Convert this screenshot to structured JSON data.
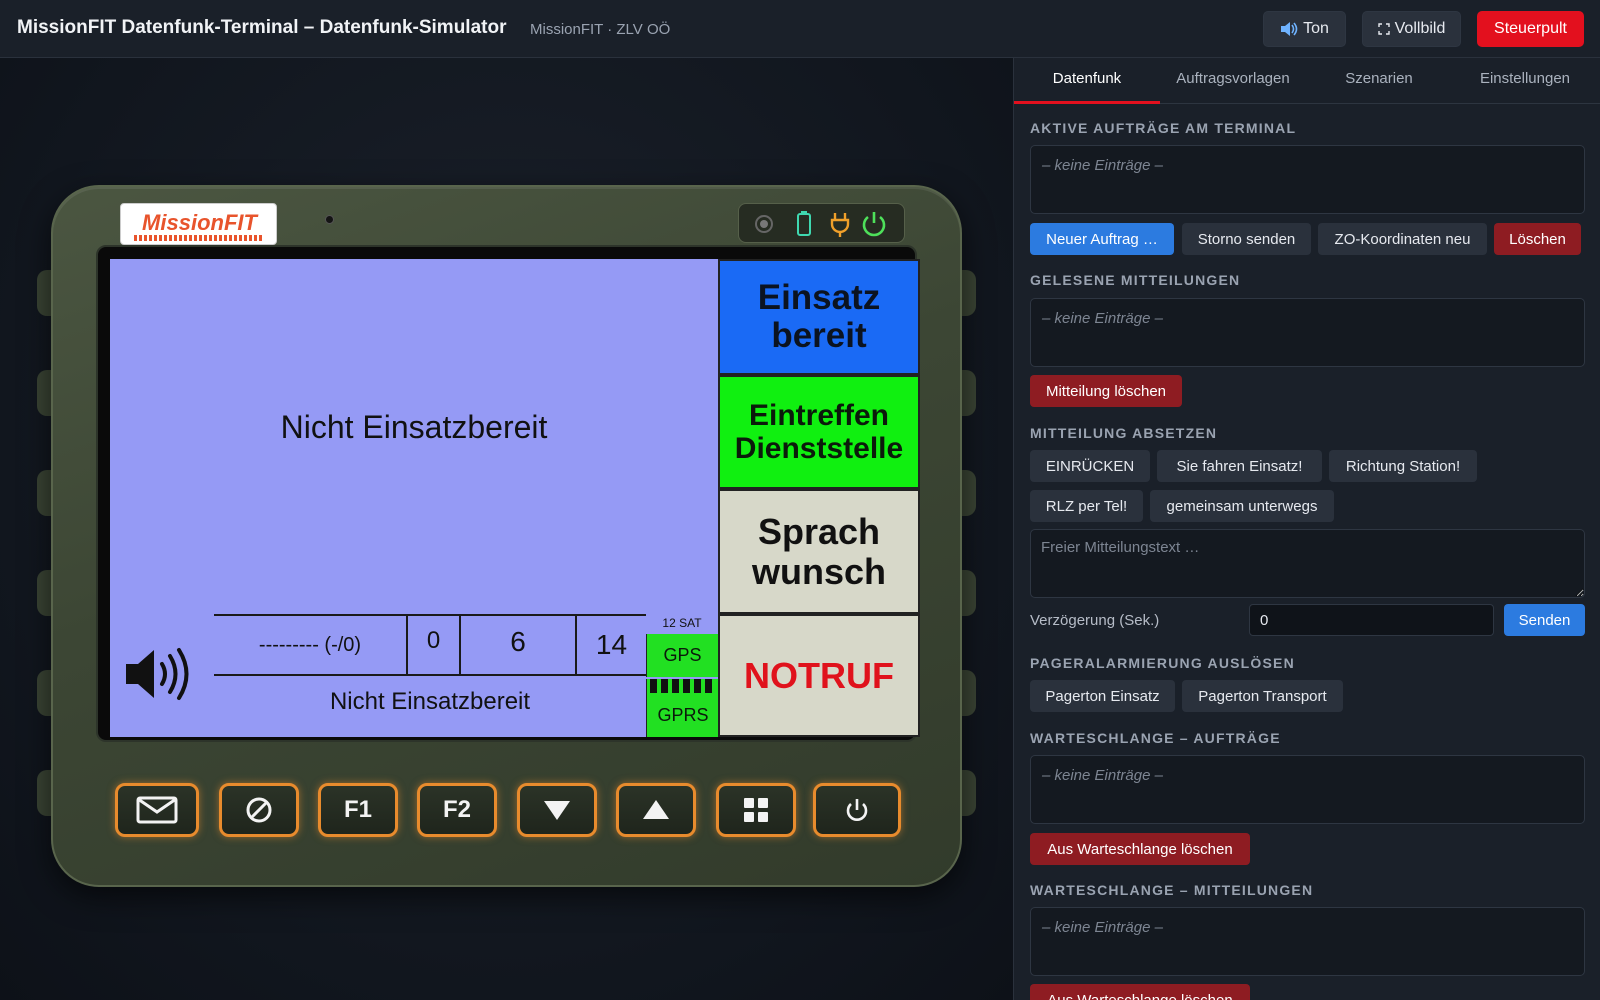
{
  "header": {
    "title": "MissionFIT Datenfunk-Terminal – Datenfunk-Simulator",
    "subtitle": "MissionFIT · ZLV OÖ",
    "buttons": {
      "sound": "Ton",
      "fullscreen": "Vollbild",
      "control": "Steuerpult"
    },
    "sound_icon": "speaker-icon",
    "fullscreen_icon": "fullscreen-icon"
  },
  "device": {
    "logo_text": "MissionFIT",
    "status_main": "Nicht Einsatzbereit",
    "side_buttons": {
      "ready_line1": "Einsatz",
      "ready_line2": "bereit",
      "arrive_line1": "Eintreffen",
      "arrive_line2": "Dienststelle",
      "voice_line1": "Sprach",
      "voice_line2": "wunsch",
      "emergency": "NOTRUF"
    },
    "info": {
      "order": "--------- (-/0)",
      "v1": "0",
      "v2": "6",
      "v3": "14",
      "sat": "12 SAT",
      "gps": "GPS",
      "gprs": "GPRS",
      "status_text": "Nicht Einsatzbereit"
    },
    "hw_buttons": {
      "f1": "F1",
      "f2": "F2"
    },
    "colors": {
      "screen_bg": "#959af5",
      "ready": "#1a6af5",
      "arrive": "#10f010",
      "voice": "#d7d8c9",
      "emergency_text": "#e0121c",
      "hw_glow": "#e88b2d"
    }
  },
  "panel": {
    "tabs": [
      "Datenfunk",
      "Auftragsvorlagen",
      "Szenarien",
      "Einstellungen"
    ],
    "active_tab": "Datenfunk",
    "empty_text": "– keine Einträge –",
    "active_orders": {
      "heading": "Aktive Aufträge am Terminal",
      "buttons": [
        "Neuer Auftrag …",
        "Storno senden",
        "ZO-Koordinaten neu",
        "Löschen"
      ]
    },
    "read_messages": {
      "heading": "Gelesene Mitteilungen",
      "delete_button": "Mitteilung löschen"
    },
    "send_message": {
      "heading": "Mitteilung absetzen",
      "quick": [
        "EINRÜCKEN",
        "Sie fahren Einsatz!",
        "Richtung Station!",
        "RLZ per Tel!",
        "gemeinsam unterwegs"
      ],
      "placeholder": "Freier Mitteilungstext …",
      "delay_label": "Verzögerung (Sek.)",
      "delay_value": "0",
      "send_button": "Senden"
    },
    "pager": {
      "heading": "Pageralarmierung auslösen",
      "buttons": [
        "Pagerton Einsatz",
        "Pagerton Transport"
      ]
    },
    "queue_orders": {
      "heading": "Warteschlange – Aufträge",
      "delete_button": "Aus Warteschlange löschen"
    },
    "queue_messages": {
      "heading": "Warteschlange – Mitteilungen",
      "delete_button": "Aus Warteschlange löschen"
    },
    "colors": {
      "accent_red": "#e3101e",
      "primary_blue": "#2c7be0",
      "danger": "#8e1c22"
    }
  }
}
